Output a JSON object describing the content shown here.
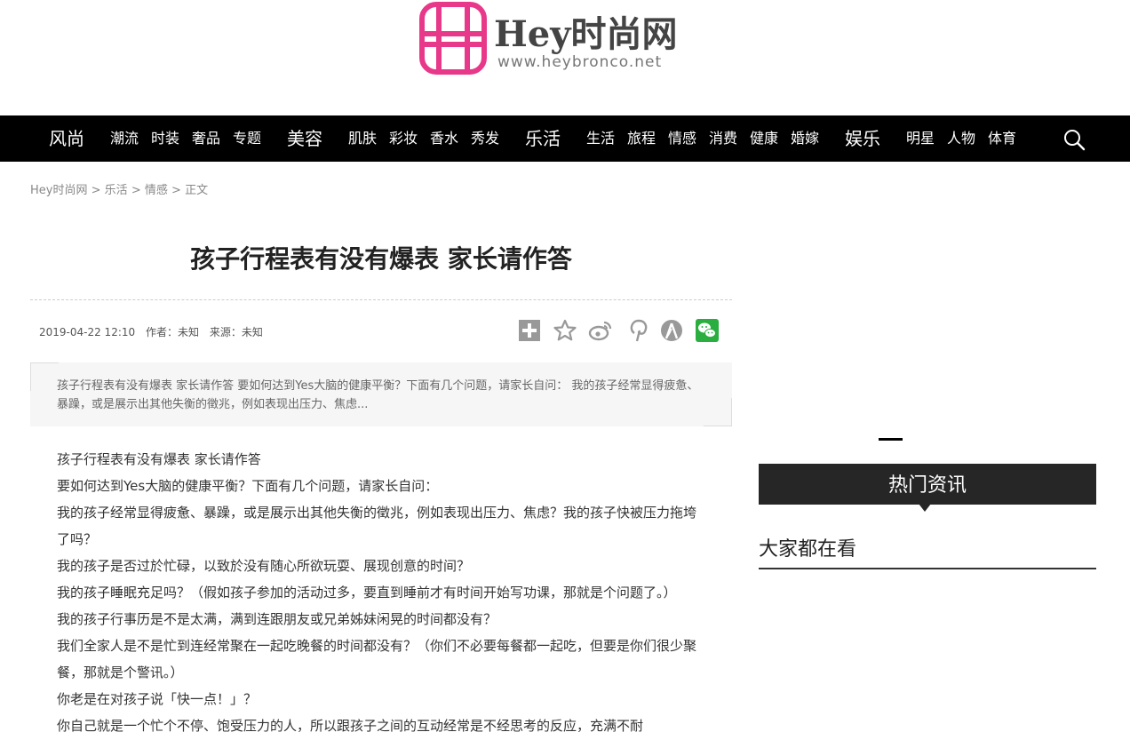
{
  "logo": {
    "title": "Hey时尚网",
    "url": "www.heybronco.net",
    "accent_color": "#e8388a"
  },
  "nav": {
    "items": [
      {
        "label": "风尚",
        "kind": "main"
      },
      {
        "label": "潮流",
        "kind": "sub"
      },
      {
        "label": "时装",
        "kind": "sub"
      },
      {
        "label": "奢品",
        "kind": "sub"
      },
      {
        "label": "专题",
        "kind": "sub"
      },
      {
        "label": "美容",
        "kind": "main"
      },
      {
        "label": "肌肤",
        "kind": "sub"
      },
      {
        "label": "彩妆",
        "kind": "sub"
      },
      {
        "label": "香水",
        "kind": "sub"
      },
      {
        "label": "秀发",
        "kind": "sub"
      },
      {
        "label": "乐活",
        "kind": "main"
      },
      {
        "label": "生活",
        "kind": "sub"
      },
      {
        "label": "旅程",
        "kind": "sub"
      },
      {
        "label": "情感",
        "kind": "sub"
      },
      {
        "label": "消费",
        "kind": "sub"
      },
      {
        "label": "健康",
        "kind": "sub"
      },
      {
        "label": "婚嫁",
        "kind": "sub"
      },
      {
        "label": "娱乐",
        "kind": "main"
      },
      {
        "label": "明星",
        "kind": "sub"
      },
      {
        "label": "人物",
        "kind": "sub"
      },
      {
        "label": "体育",
        "kind": "sub"
      }
    ],
    "search_icon": "search-icon",
    "background": "#000000"
  },
  "breadcrumb": {
    "home": "Hey时尚网",
    "sep": ">",
    "level1": "乐活",
    "level2": "情感",
    "current": "正文"
  },
  "article": {
    "title": "孩子行程表有没有爆表 家长请作答",
    "date": "2019-04-22 12:10",
    "author": "作者：未知",
    "source": "来源：未知",
    "summary": "孩子行程表有没有爆表 家长请作答 要如何达到Yes大脑的健康平衡？下面有几个问题，请家长自问： 我的孩子经常显得疲惫、暴躁，或是展示出其他失衡的徵兆，例如表现出压力、焦虑...",
    "paragraphs": [
      "孩子行程表有没有爆表 家长请作答",
      "要如何达到Yes大脑的健康平衡？下面有几个问题，请家长自问：",
      "我的孩子经常显得疲惫、暴躁，或是展示出其他失衡的徵兆，例如表现出压力、焦虑？我的孩子快被压力拖垮了吗？",
      "我的孩子是否过於忙碌，以致於没有随心所欲玩耍、展现创意的时间？",
      "我的孩子睡眠充足吗？（假如孩子参加的活动过多，要直到睡前才有时间开始写功课，那就是个问题了。）",
      "我的孩子行事历是不是太满，满到连跟朋友或兄弟姊妹闲晃的时间都没有？",
      "我们全家人是不是忙到连经常聚在一起吃晚餐的时间都没有？（你们不必要每餐都一起吃，但要是你们很少聚餐，那就是个警讯。）",
      "你老是在对孩子说「快一点！」？",
      "你自己就是一个忙个不停、饱受压力的人，所以跟孩子之间的互动经常是不经思考的反应，充满不耐"
    ]
  },
  "share": {
    "icons": [
      "plus-icon",
      "star-icon",
      "weibo-icon",
      "pinterest-icon",
      "renren-icon",
      "wechat-icon"
    ],
    "wechat_color": "#2aae3f"
  },
  "sidebar": {
    "hot_title": "热门资讯",
    "watching_title": "大家都在看"
  }
}
